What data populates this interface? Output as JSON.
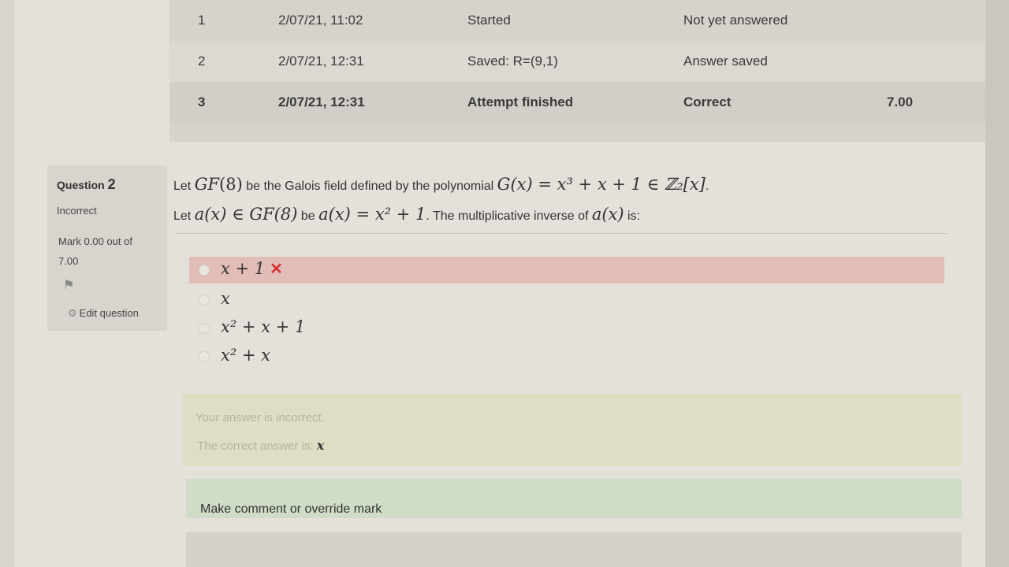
{
  "history": {
    "rows": [
      {
        "step": "1",
        "time": "2/07/21, 11:02",
        "action": "Started",
        "state": "Not yet answered",
        "marks": ""
      },
      {
        "step": "2",
        "time": "2/07/21, 12:31",
        "action": "Saved: R=(9,1)",
        "state": "Answer saved",
        "marks": ""
      },
      {
        "step": "3",
        "time": "2/07/21, 12:31",
        "action": "Attempt finished",
        "state": "Correct",
        "marks": "7.00"
      }
    ]
  },
  "question": {
    "label": "Question",
    "number": "2",
    "state": "Incorrect",
    "mark": "Mark 0.00 out of 7.00",
    "flag_icon": "flag-icon",
    "edit_label": "Edit question",
    "text": {
      "l1_a": "Let ",
      "l1_gf": "GF",
      "l1_gf_arg": "(8)",
      "l1_b": " be the Galois field defined by the polynomial ",
      "l1_poly": "G(x) = x³ + x + 1 ∈ ℤ₂[x]",
      "l1_end": ".",
      "l2_a": "Let ",
      "l2_ax": "a(x) ∈ GF(8)",
      "l2_b": " be ",
      "l2_def": "a(x) = x² + 1",
      "l2_c": ". The multiplicative inverse of ",
      "l2_ax2": "a(x)",
      "l2_d": " is:"
    },
    "answers": [
      {
        "text": "x + 1",
        "wrong": true
      },
      {
        "text": "x",
        "wrong": false
      },
      {
        "text": "x² + x + 1",
        "wrong": false
      },
      {
        "text": "x² + x",
        "wrong": false
      }
    ],
    "wrong_mark": "✕",
    "feedback": {
      "incorrect": "Your answer is incorrect.",
      "correct_prefix": "The correct answer is: ",
      "correct_answer": "x"
    },
    "comment_label": "Make comment or override mark"
  }
}
